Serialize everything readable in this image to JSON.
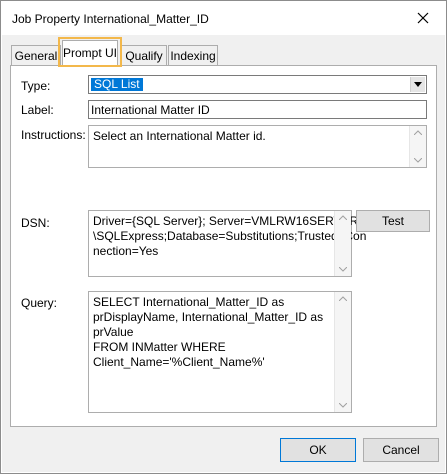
{
  "window": {
    "title": "Job Property International_Matter_ID"
  },
  "tabs": [
    {
      "label": "General"
    },
    {
      "label": "Prompt UI"
    },
    {
      "label": "Qualify"
    },
    {
      "label": "Indexing"
    }
  ],
  "active_tab": "Prompt UI",
  "form": {
    "type_label": "Type:",
    "type_value": "SQL List",
    "label_label": "Label:",
    "label_value": "International Matter ID",
    "instructions_label": "Instructions:",
    "instructions_value": "Select an International Matter id.",
    "dsn_label": "DSN:",
    "dsn_value": "Driver={SQL Server}; Server=VMLRW16SERVER\n\\SQLExpress;Database=Substitutions;Trusted_Con\nnection=Yes",
    "test_button": "Test",
    "query_label": "Query:",
    "query_value": "SELECT International_Matter_ID as\nprDisplayName, International_Matter_ID as prValue\nFROM INMatter WHERE\nClient_Name='%Client_Name%'"
  },
  "buttons": {
    "ok": "OK",
    "cancel": "Cancel"
  },
  "colors": {
    "highlight": "#f3b84b",
    "selection": "#0078d7"
  }
}
